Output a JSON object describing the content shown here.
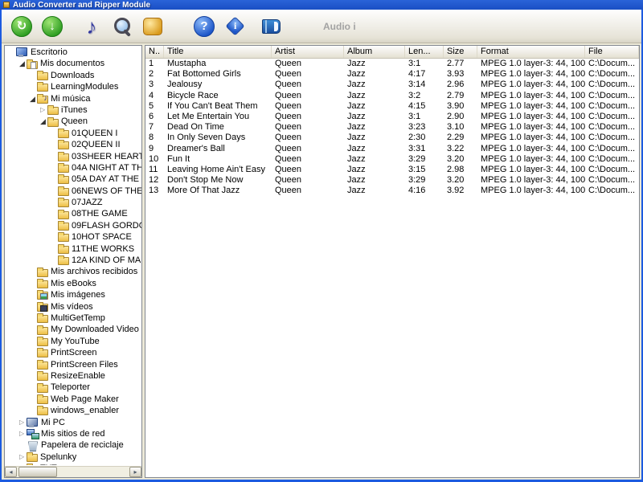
{
  "window": {
    "title": "Audio Converter and Ripper Module"
  },
  "toolbar": {
    "caption": "Audio i",
    "refresh_glyph": "↻",
    "download_glyph": "↓",
    "note_glyph": "♪",
    "help_glyph": "?",
    "info_glyph": "i"
  },
  "scrollbar": {
    "left_glyph": "◂",
    "right_glyph": "▸"
  },
  "tree": {
    "collapsed_glyph": "▷",
    "expanded_glyph": "◢",
    "items": [
      {
        "label": "Escritorio",
        "level": 0,
        "icon": "desktop",
        "expand": "none"
      },
      {
        "label": "Mis documentos",
        "level": 1,
        "icon": "folder-docs",
        "expand": "expanded"
      },
      {
        "label": "Downloads",
        "level": 2,
        "icon": "folder",
        "expand": "none"
      },
      {
        "label": "LearningModules",
        "level": 2,
        "icon": "folder",
        "expand": "none"
      },
      {
        "label": "Mi música",
        "level": 2,
        "icon": "folder-music",
        "expand": "expanded"
      },
      {
        "label": "iTunes",
        "level": 3,
        "icon": "folder",
        "expand": "collapsed"
      },
      {
        "label": "Queen",
        "level": 3,
        "icon": "folder",
        "expand": "expanded"
      },
      {
        "label": "01QUEEN I",
        "level": 4,
        "icon": "folder",
        "expand": "none"
      },
      {
        "label": "02QUEEN II",
        "level": 4,
        "icon": "folder",
        "expand": "none"
      },
      {
        "label": "03SHEER HEART",
        "level": 4,
        "icon": "folder",
        "expand": "none"
      },
      {
        "label": "04A NIGHT AT TH",
        "level": 4,
        "icon": "folder",
        "expand": "none"
      },
      {
        "label": "05A DAY AT THE",
        "level": 4,
        "icon": "folder",
        "expand": "none"
      },
      {
        "label": "06NEWS OF THE",
        "level": 4,
        "icon": "folder",
        "expand": "none"
      },
      {
        "label": "07JAZZ",
        "level": 4,
        "icon": "folder",
        "expand": "none"
      },
      {
        "label": "08THE GAME",
        "level": 4,
        "icon": "folder",
        "expand": "none"
      },
      {
        "label": "09FLASH GORDO",
        "level": 4,
        "icon": "folder",
        "expand": "none"
      },
      {
        "label": "10HOT SPACE",
        "level": 4,
        "icon": "folder",
        "expand": "none"
      },
      {
        "label": "11THE WORKS",
        "level": 4,
        "icon": "folder",
        "expand": "none"
      },
      {
        "label": "12A KIND OF MA",
        "level": 4,
        "icon": "folder",
        "expand": "none"
      },
      {
        "label": "Mis archivos recibidos",
        "level": 2,
        "icon": "folder",
        "expand": "none"
      },
      {
        "label": "Mis eBooks",
        "level": 2,
        "icon": "folder",
        "expand": "none"
      },
      {
        "label": "Mis imágenes",
        "level": 2,
        "icon": "folder-image",
        "expand": "none"
      },
      {
        "label": "Mis vídeos",
        "level": 2,
        "icon": "folder-video",
        "expand": "none"
      },
      {
        "label": "MultiGetTemp",
        "level": 2,
        "icon": "folder",
        "expand": "none"
      },
      {
        "label": "My Downloaded Video",
        "level": 2,
        "icon": "folder",
        "expand": "none"
      },
      {
        "label": "My YouTube",
        "level": 2,
        "icon": "folder",
        "expand": "none"
      },
      {
        "label": "PrintScreen",
        "level": 2,
        "icon": "folder",
        "expand": "none"
      },
      {
        "label": "PrintScreen Files",
        "level": 2,
        "icon": "folder",
        "expand": "none"
      },
      {
        "label": "ResizeEnable",
        "level": 2,
        "icon": "folder",
        "expand": "none"
      },
      {
        "label": "Teleporter",
        "level": 2,
        "icon": "folder",
        "expand": "none"
      },
      {
        "label": "Web Page Maker",
        "level": 2,
        "icon": "folder",
        "expand": "none"
      },
      {
        "label": "windows_enabler",
        "level": 2,
        "icon": "folder",
        "expand": "none"
      },
      {
        "label": "Mi PC",
        "level": 1,
        "icon": "computer",
        "expand": "collapsed"
      },
      {
        "label": "Mis sitios de red",
        "level": 1,
        "icon": "network",
        "expand": "collapsed"
      },
      {
        "label": "Papelera de reciclaje",
        "level": 1,
        "icon": "recycle",
        "expand": "none"
      },
      {
        "label": "Spelunky",
        "level": 1,
        "icon": "folder",
        "expand": "collapsed"
      },
      {
        "label": "TXTs",
        "level": 1,
        "icon": "folder",
        "expand": "none"
      }
    ]
  },
  "table": {
    "columns": [
      "N..",
      "Title",
      "Artist",
      "Album",
      "Len...",
      "Size",
      "Format",
      "File"
    ],
    "rows": [
      {
        "n": "1",
        "title": "Mustapha",
        "artist": "Queen",
        "album": "Jazz",
        "len": "3:1",
        "size": "2.77",
        "format": "MPEG 1.0 layer-3: 44, 100...",
        "file": "C:\\Docum..."
      },
      {
        "n": "2",
        "title": "Fat Bottomed Girls",
        "artist": "Queen",
        "album": "Jazz",
        "len": "4:17",
        "size": "3.93",
        "format": "MPEG 1.0 layer-3: 44, 100...",
        "file": "C:\\Docum..."
      },
      {
        "n": "3",
        "title": "Jealousy",
        "artist": "Queen",
        "album": "Jazz",
        "len": "3:14",
        "size": "2.96",
        "format": "MPEG 1.0 layer-3: 44, 100...",
        "file": "C:\\Docum..."
      },
      {
        "n": "4",
        "title": "Bicycle Race",
        "artist": "Queen",
        "album": "Jazz",
        "len": "3:2",
        "size": "2.79",
        "format": "MPEG 1.0 layer-3: 44, 100...",
        "file": "C:\\Docum..."
      },
      {
        "n": "5",
        "title": "If You  Can't Beat Them",
        "artist": "Queen",
        "album": "Jazz",
        "len": "4:15",
        "size": "3.90",
        "format": "MPEG 1.0 layer-3: 44, 100...",
        "file": "C:\\Docum..."
      },
      {
        "n": "6",
        "title": "Let Me Entertain You",
        "artist": "Queen",
        "album": "Jazz",
        "len": "3:1",
        "size": "2.90",
        "format": "MPEG 1.0 layer-3: 44, 100...",
        "file": "C:\\Docum..."
      },
      {
        "n": "7",
        "title": "Dead On Time",
        "artist": "Queen",
        "album": "Jazz",
        "len": "3:23",
        "size": "3.10",
        "format": "MPEG 1.0 layer-3: 44, 100...",
        "file": "C:\\Docum..."
      },
      {
        "n": "8",
        "title": "In Only Seven Days",
        "artist": "Queen",
        "album": "Jazz",
        "len": "2:30",
        "size": "2.29",
        "format": "MPEG 1.0 layer-3: 44, 100...",
        "file": "C:\\Docum..."
      },
      {
        "n": "9",
        "title": "Dreamer's Ball",
        "artist": "Queen",
        "album": "Jazz",
        "len": "3:31",
        "size": "3.22",
        "format": "MPEG 1.0 layer-3: 44, 100...",
        "file": "C:\\Docum..."
      },
      {
        "n": "10",
        "title": "Fun It",
        "artist": "Queen",
        "album": "Jazz",
        "len": "3:29",
        "size": "3.20",
        "format": "MPEG 1.0 layer-3: 44, 100...",
        "file": "C:\\Docum..."
      },
      {
        "n": "11",
        "title": "Leaving Home Ain't Easy",
        "artist": "Queen",
        "album": "Jazz",
        "len": "3:15",
        "size": "2.98",
        "format": "MPEG 1.0 layer-3: 44, 100...",
        "file": "C:\\Docum..."
      },
      {
        "n": "12",
        "title": "Don't Stop Me Now",
        "artist": "Queen",
        "album": "Jazz",
        "len": "3:29",
        "size": "3.20",
        "format": "MPEG 1.0 layer-3: 44, 100...",
        "file": "C:\\Docum..."
      },
      {
        "n": "13",
        "title": "More Of That Jazz",
        "artist": "Queen",
        "album": "Jazz",
        "len": "4:16",
        "size": "3.92",
        "format": "MPEG 1.0 layer-3: 44, 100...",
        "file": "C:\\Docum..."
      }
    ]
  }
}
